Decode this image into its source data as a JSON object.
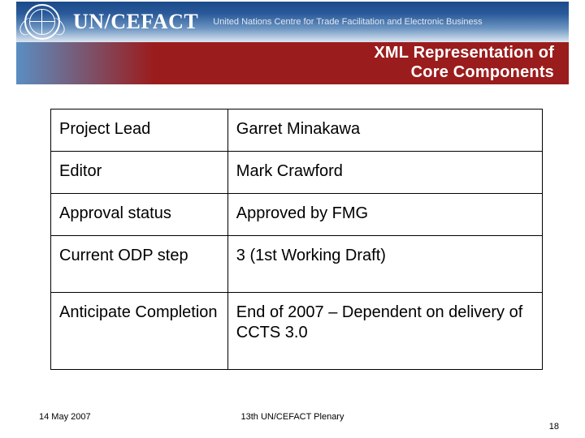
{
  "header": {
    "brand": "UN/CEFACT",
    "subtitle": "United Nations Centre for Trade Facilitation and Electronic Business",
    "slide_title_line1": "XML Representation of",
    "slide_title_line2": "Core Components"
  },
  "table": {
    "rows": [
      {
        "label": "Project Lead",
        "value": "Garret Minakawa"
      },
      {
        "label": "Editor",
        "value": "Mark Crawford"
      },
      {
        "label": "Approval status",
        "value": "Approved by FMG"
      },
      {
        "label": "Current ODP step",
        "value": "3 (1st Working Draft)"
      },
      {
        "label": "Anticipate Completion",
        "value": "End of 2007 – Dependent on delivery of CCTS 3.0"
      }
    ]
  },
  "footer": {
    "date": "14 May 2007",
    "center": "13th UN/CEFACT Plenary",
    "page": "18"
  }
}
